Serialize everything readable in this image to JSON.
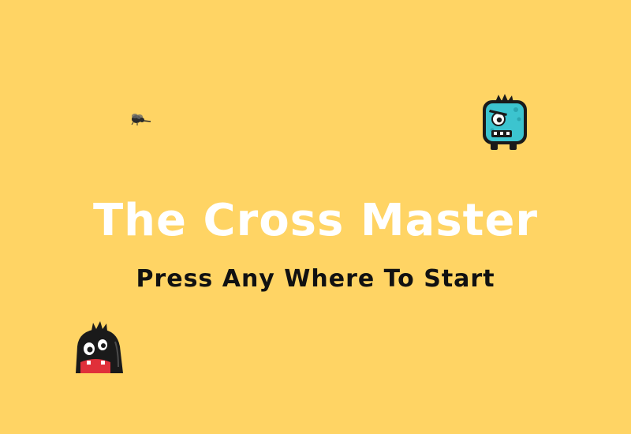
{
  "game": {
    "title": "The Cross Master",
    "prompt": "Press Any Where To Start"
  },
  "colors": {
    "background": "#FFD464",
    "title_text": "#FFFFFF",
    "prompt_text": "#111111",
    "teal_monster": "#3CC4CF",
    "black_monster": "#1A1A1A",
    "monster_mouth": "#E0303A"
  },
  "sprites": [
    "fly-sprite",
    "teal-monster-sprite",
    "black-monster-sprite"
  ]
}
